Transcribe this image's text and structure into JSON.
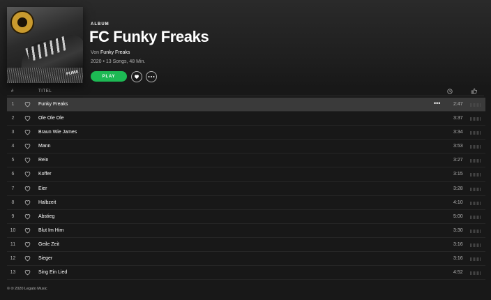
{
  "album": {
    "label": "ALBUM",
    "title": "FC Funky Freaks",
    "by_prefix": "Von",
    "artist": "Funky Freaks",
    "meta": "2020 • 13 Songs, 48 Min.",
    "cover_brand": "PUMA"
  },
  "actions": {
    "play_label": "PLAY",
    "heart_icon": "heart-icon",
    "more_icon": "more-icon"
  },
  "columns": {
    "number": "#",
    "title": "TITEL",
    "duration_icon": "clock-icon",
    "popularity_icon": "thumbs-up-icon"
  },
  "tracks": [
    {
      "num": "1",
      "title": "Funky Freaks",
      "duration": "2:47",
      "active": true
    },
    {
      "num": "2",
      "title": "Ole Ole Ole",
      "duration": "3:37"
    },
    {
      "num": "3",
      "title": "Braun Wie James",
      "duration": "3:34"
    },
    {
      "num": "4",
      "title": "Mann",
      "duration": "3:53"
    },
    {
      "num": "5",
      "title": "Rein",
      "duration": "3:27"
    },
    {
      "num": "6",
      "title": "Koffer",
      "duration": "3:15"
    },
    {
      "num": "7",
      "title": "Eier",
      "duration": "3:28"
    },
    {
      "num": "8",
      "title": "Halbzeit",
      "duration": "4:10"
    },
    {
      "num": "9",
      "title": "Abstieg",
      "duration": "5:00"
    },
    {
      "num": "10",
      "title": "Blut Im Hirn",
      "duration": "3:30"
    },
    {
      "num": "11",
      "title": "Geile Zeit",
      "duration": "3:16"
    },
    {
      "num": "12",
      "title": "Sieger",
      "duration": "3:16"
    },
    {
      "num": "13",
      "title": "Sing Ein Lied",
      "duration": "4:52"
    }
  ],
  "footer": {
    "copyright": "© ℗ 2020 Legato Music"
  },
  "colors": {
    "accent": "#1db954",
    "background": "#181818",
    "active_row": "#3a3a3a"
  }
}
